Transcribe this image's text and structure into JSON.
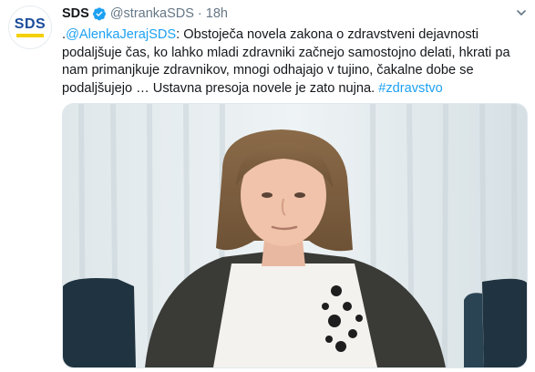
{
  "tweet": {
    "avatar_text": "SDS",
    "display_name": "SDS",
    "handle": "@strankaSDS",
    "separator": "·",
    "time": "18h",
    "text": {
      "prefix": ".",
      "mention": "@AlenkaJerajSDS",
      "body": ": Obstoječa novela zakona o zdravstveni dejavnosti podaljšuje čas, ko lahko mladi zdravniki začnejo samostojno delati, hkrati pa nam primanjkuje zdravnikov, mnogi odhajajo v tujino, čakalne dobe se podaljšujejo … Ustavna presoja novele je zato nujna. ",
      "hashtag": "#zdravstvo"
    }
  },
  "colors": {
    "link": "#1da1f2",
    "verified": "#1da1f2",
    "brand_blue": "#1a4c9c",
    "brand_yellow": "#f5d000"
  },
  "icons": {
    "verified": "verified-badge-icon",
    "caret": "chevron-down-icon"
  }
}
